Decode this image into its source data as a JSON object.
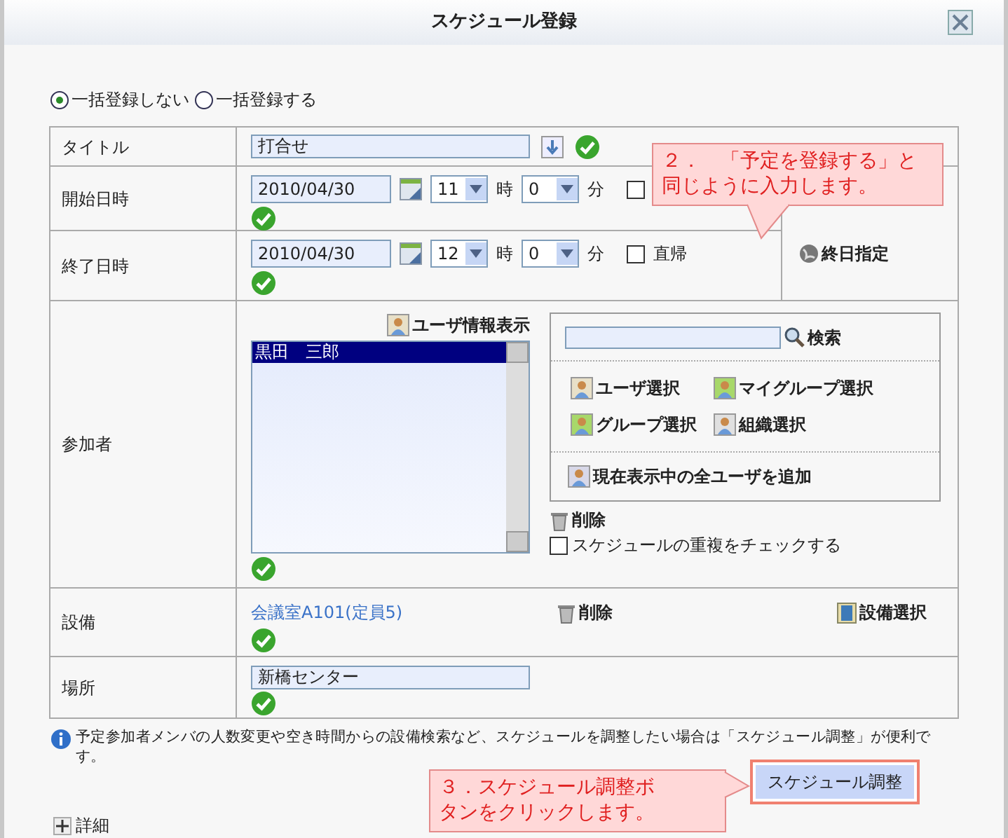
{
  "window": {
    "title": "スケジュール登録"
  },
  "bulk_options": [
    {
      "label": "一括登録しない",
      "selected": true
    },
    {
      "label": "一括登録する",
      "selected": false
    }
  ],
  "form": {
    "title": {
      "label": "タイトル",
      "value": "打合せ"
    },
    "start": {
      "label": "開始日時",
      "date": "2010/04/30",
      "hour": "11",
      "hour_unit": "時",
      "minute": "0",
      "minute_unit": "分",
      "direct_checked": false
    },
    "end": {
      "label": "終了日時",
      "date": "2010/04/30",
      "hour": "12",
      "hour_unit": "時",
      "minute": "0",
      "minute_unit": "分",
      "direct_label": "直帰",
      "direct_checked": false
    },
    "all_day": "終日指定",
    "participants": {
      "label": "参加者",
      "user_info": "ユーザ情報表示",
      "members": [
        {
          "name": "黒田　三郎",
          "selected": true
        }
      ],
      "search_button": "検索",
      "select_buttons": [
        {
          "label": "ユーザ選択",
          "kind": "user"
        },
        {
          "label": "マイグループ選択",
          "kind": "mygroup"
        },
        {
          "label": "グループ選択",
          "kind": "group"
        },
        {
          "label": "組織選択",
          "kind": "org"
        }
      ],
      "add_all": "現在表示中の全ユーザを追加",
      "delete": "削除",
      "duplicate_check": {
        "label": "スケジュールの重複をチェックする",
        "checked": false
      }
    },
    "equipment": {
      "label": "設備",
      "link": "会議室A101(定員5)",
      "delete": "削除",
      "select": "設備選択"
    },
    "place": {
      "label": "場所",
      "value": "新橋センター"
    }
  },
  "info": "予定参加者メンバの人数変更や空き時間からの設備検索など、スケジュールを調整したい場合は「スケジュール調整」が便利です。",
  "adjust_button": "スケジュール調整",
  "details": "詳細",
  "callouts": [
    {
      "lines": [
        "２．　「予定を登録する」と",
        "同じように入力します。"
      ]
    },
    {
      "lines": [
        "３．スケジュール調整ボ",
        "タンをクリックします。"
      ]
    }
  ]
}
